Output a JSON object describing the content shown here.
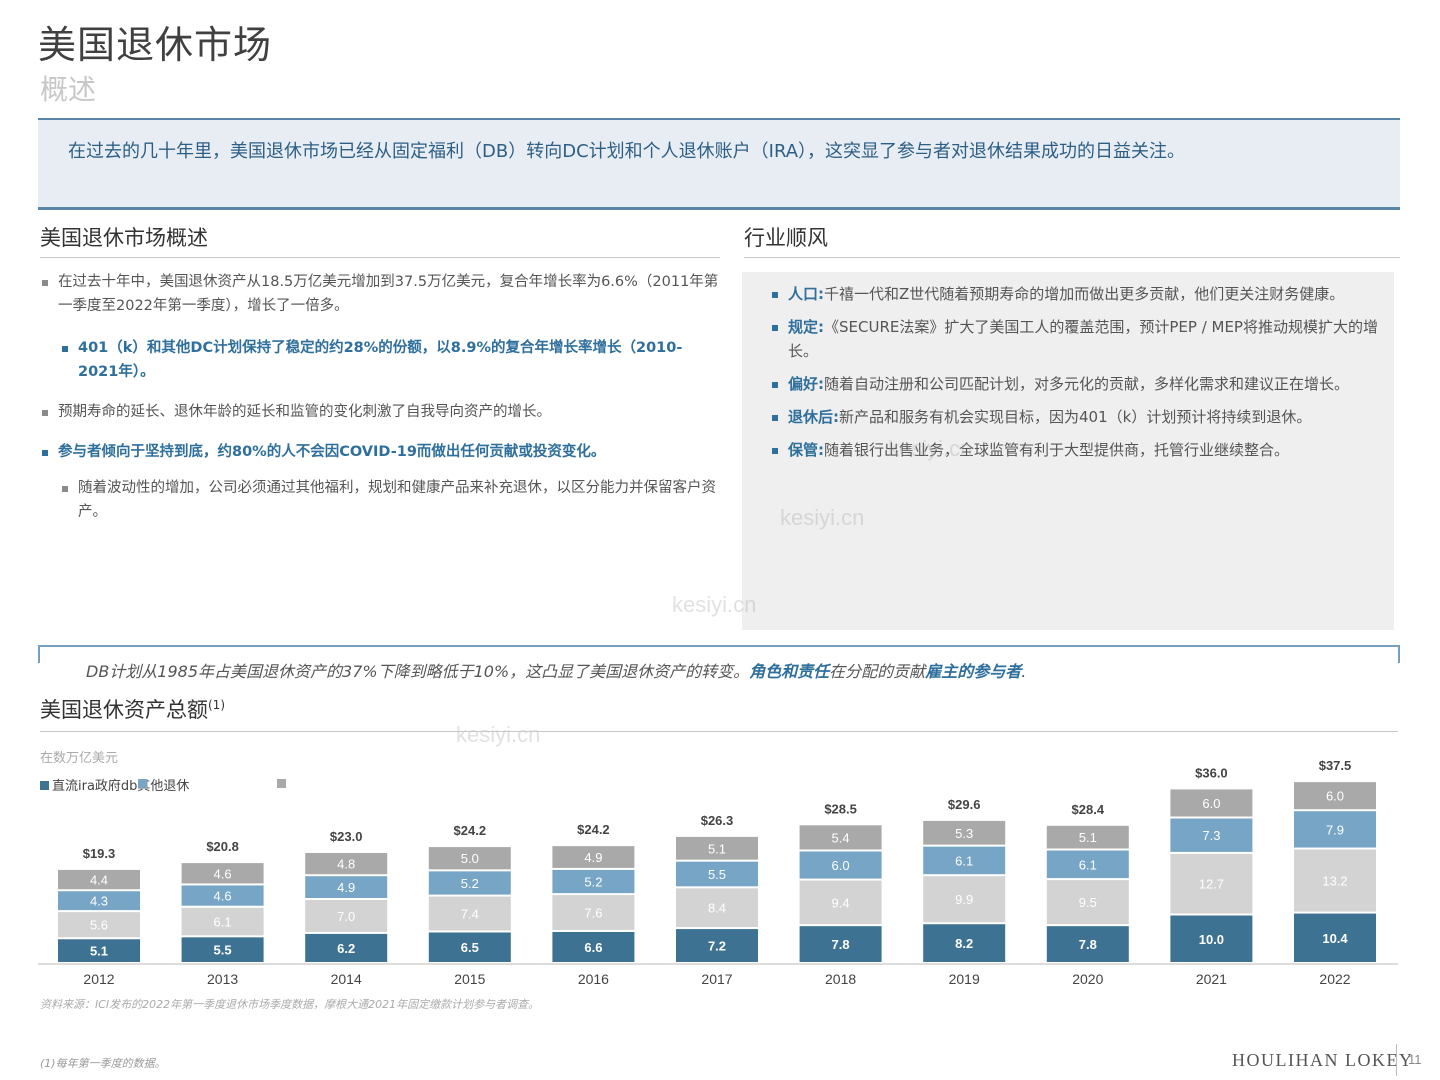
{
  "header": {
    "title": "美国退休市场",
    "subtitle": "概述"
  },
  "summary": "在过去的几十年里，美国退休市场已经从固定福利（DB）转向DC计划和个人退休账户（IRA），这突显了参与者对退休结果成功的日益关注。",
  "left_section": {
    "heading": "美国退休市场概述",
    "b1": "在过去十年中，美国退休资产从18.5万亿美元增加到37.5万亿美元，复合年增长率为6.6%（2011年第一季度至2022年第一季度），增长了一倍多。",
    "b2": "401（k）和其他DC计划保持了稳定的约28%的份额，以8.9%的复合年增长率增长（2010-2021年）。",
    "b3": "预期寿命的延长、退休年龄的延长和监管的变化刺激了自我导向资产的增长。",
    "b4": "参与者倾向于坚持到底，约80%的人不会因COVID-19而做出任何贡献或投资变化。",
    "b5": "随着波动性的增加，公司必须通过其他福利，规划和健康产品来补充退休，以区分能力并保留客户资产。"
  },
  "right_section": {
    "heading": "行业顺风",
    "items": [
      {
        "key": "人口:",
        "text": "千禧一代和Z世代随着预期寿命的增加而做出更多贡献，他们更关注财务健康。"
      },
      {
        "key": "规定:",
        "text": "《SECURE法案》扩大了美国工人的覆盖范围，预计PEP / MEP将推动规模扩大的增长。"
      },
      {
        "key": "偏好:",
        "text": "随着自动注册和公司匹配计划，对多元化的贡献，多样化需求和建议正在增长。"
      },
      {
        "key": "退休后:",
        "text": "新产品和服务有机会实现目标，因为401（k）计划预计将持续到退休。"
      },
      {
        "key": "保管:",
        "text": "随着银行出售业务，全球监管有利于大型提供商，托管行业继续整合。"
      }
    ]
  },
  "note": {
    "p1": "DB计划从1985年占美国退休资产的37%下降到略低于10%，这凸显了美国退休资产的转变。",
    "em1": "角色和责任",
    "p2": "在分配的贡献",
    "em2": "雇主的参与者",
    "p3": "."
  },
  "chart_title": "美国退休资产总额",
  "chart_title_sup": "(1)",
  "unit_label": "在数万亿美元",
  "legend_text": "直流ira政府db其他退休",
  "source": "资料来源：ICI发布的2022年第一季度退休市场季度数据，摩根大通2021年固定缴款计划参与者调查。",
  "footnote": "(1)每年第一季度的数据。",
  "brand": "HOULIHAN LOKEY",
  "page_number": "11",
  "watermark": "kesiyi.cn",
  "colors": {
    "s1": "#3e7293",
    "s2": "#d3d3d3",
    "s3": "#77a5c6",
    "s4": "#a9a9a9",
    "accent": "#2f6f9c"
  },
  "chart_data": {
    "type": "bar",
    "stacked": true,
    "categories": [
      "2012",
      "2013",
      "2014",
      "2015",
      "2016",
      "2017",
      "2018",
      "2019",
      "2020",
      "2021",
      "2022"
    ],
    "series": [
      {
        "values": [
          5.1,
          5.5,
          6.2,
          6.5,
          6.6,
          7.2,
          7.8,
          8.2,
          7.8,
          10.0,
          10.4
        ]
      },
      {
        "values": [
          5.6,
          6.1,
          7.0,
          7.4,
          7.6,
          8.4,
          9.4,
          9.9,
          9.5,
          12.7,
          13.2
        ]
      },
      {
        "values": [
          4.3,
          4.6,
          4.9,
          5.2,
          5.2,
          5.5,
          6.0,
          6.1,
          6.1,
          7.3,
          7.9
        ]
      },
      {
        "values": [
          4.4,
          4.6,
          4.8,
          5.0,
          4.9,
          5.1,
          5.4,
          5.3,
          5.1,
          6.0,
          6.0
        ]
      }
    ],
    "value_labels": [
      [
        "5.1",
        "5.5",
        "6.2",
        "6.5",
        "6.6",
        "7.2",
        "7.8",
        "8.2",
        "7.8",
        "10.0",
        "10.4"
      ],
      [
        "5.6",
        "6.1",
        "7.0",
        "7.4",
        "7.6",
        "8.4",
        "9.4",
        "9.9",
        "9.5",
        "12.7",
        "13.2"
      ],
      [
        "4.3",
        "4.6",
        "4.9",
        "5.2",
        "5.2",
        "5.5",
        "6.0",
        "6.1",
        "6.1",
        "7.3",
        "7.9"
      ],
      [
        "4.4",
        "4.6",
        "4.8",
        "5.0",
        "4.9",
        "5.1",
        "5.4",
        "5.3",
        "5.1",
        "6.0",
        "6.0"
      ]
    ],
    "totals": [
      "$19.3",
      "$20.8",
      "$23.0",
      "$24.2",
      "$24.2",
      "$26.3",
      "$28.5",
      "$29.6",
      "$28.4",
      "$36.0",
      "$37.5"
    ]
  }
}
